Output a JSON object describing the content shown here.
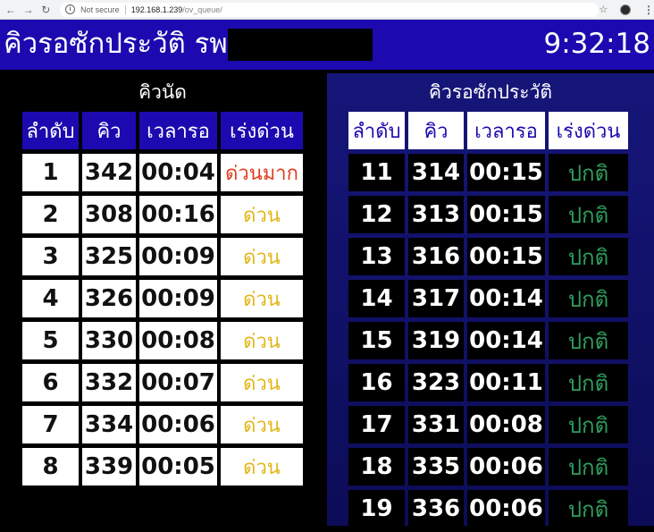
{
  "browser": {
    "not_secure": "Not secure",
    "url_host": "192.168.1.239",
    "url_path": "/ov_queue/"
  },
  "header": {
    "title": "คิวรอซักประวัติ รพ.",
    "clock": "9:32:18",
    "colors": {
      "header_bg": "#1c0ab0",
      "redaction": "#000000"
    }
  },
  "appointment": {
    "title": "คิวนัด",
    "headers": [
      "ลำดับ",
      "คิว",
      "เวลารอ",
      "เร่งด่วน"
    ],
    "rows": [
      {
        "order": "1",
        "queue": "342",
        "wait": "00:04",
        "priority": "ด่วนมาก",
        "level": "very"
      },
      {
        "order": "2",
        "queue": "308",
        "wait": "00:16",
        "priority": "ด่วน",
        "level": "urgent"
      },
      {
        "order": "3",
        "queue": "325",
        "wait": "00:09",
        "priority": "ด่วน",
        "level": "urgent"
      },
      {
        "order": "4",
        "queue": "326",
        "wait": "00:09",
        "priority": "ด่วน",
        "level": "urgent"
      },
      {
        "order": "5",
        "queue": "330",
        "wait": "00:08",
        "priority": "ด่วน",
        "level": "urgent"
      },
      {
        "order": "6",
        "queue": "332",
        "wait": "00:07",
        "priority": "ด่วน",
        "level": "urgent"
      },
      {
        "order": "7",
        "queue": "334",
        "wait": "00:06",
        "priority": "ด่วน",
        "level": "urgent"
      },
      {
        "order": "8",
        "queue": "339",
        "wait": "00:05",
        "priority": "ด่วน",
        "level": "urgent"
      }
    ]
  },
  "history": {
    "title": "คิวรอซักประวัติ",
    "headers": [
      "ลำดับ",
      "คิว",
      "เวลารอ",
      "เร่งด่วน"
    ],
    "rows": [
      {
        "order": "11",
        "queue": "314",
        "wait": "00:15",
        "priority": "ปกติ"
      },
      {
        "order": "12",
        "queue": "313",
        "wait": "00:15",
        "priority": "ปกติ"
      },
      {
        "order": "13",
        "queue": "316",
        "wait": "00:15",
        "priority": "ปกติ"
      },
      {
        "order": "14",
        "queue": "317",
        "wait": "00:14",
        "priority": "ปกติ"
      },
      {
        "order": "15",
        "queue": "319",
        "wait": "00:14",
        "priority": "ปกติ"
      },
      {
        "order": "16",
        "queue": "323",
        "wait": "00:11",
        "priority": "ปกติ"
      },
      {
        "order": "17",
        "queue": "331",
        "wait": "00:08",
        "priority": "ปกติ"
      },
      {
        "order": "18",
        "queue": "335",
        "wait": "00:06",
        "priority": "ปกติ"
      },
      {
        "order": "19",
        "queue": "336",
        "wait": "00:06",
        "priority": "ปกติ"
      }
    ]
  },
  "colors": {
    "priority_very": "#e03c20",
    "priority_urgent": "#e2b616",
    "priority_normal": "#2e9e5b"
  }
}
